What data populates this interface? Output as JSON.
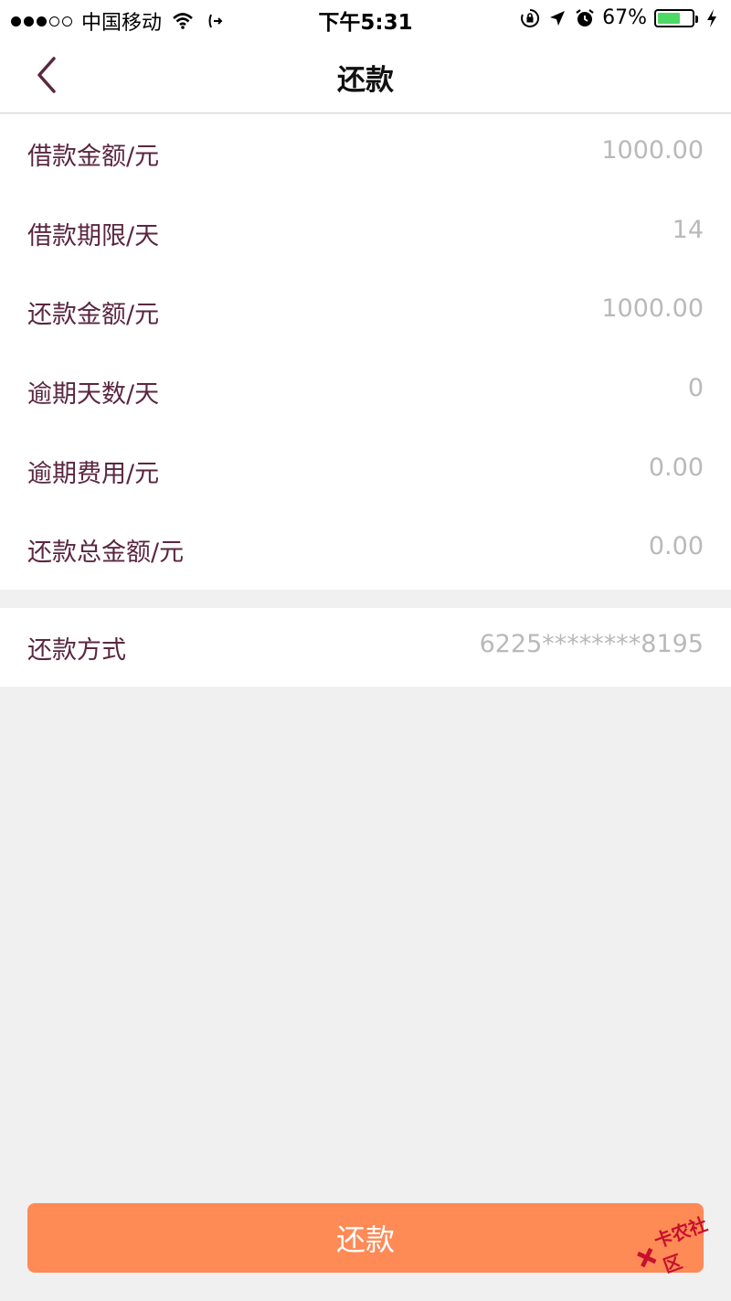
{
  "status_bar": {
    "carrier": "中国移动",
    "time": "下午5:31",
    "battery_percent": "67%",
    "battery_level": 0.67,
    "icons": [
      "signal-dots",
      "wifi-icon",
      "call-forward-icon",
      "orientation-lock-icon",
      "location-arrow-icon",
      "alarm-icon",
      "battery-icon",
      "charging-bolt-icon"
    ]
  },
  "nav": {
    "title": "还款",
    "back_icon": "chevron-left-icon"
  },
  "details": [
    {
      "label": "借款金额/元",
      "value": "1000.00"
    },
    {
      "label": "借款期限/天",
      "value": "14"
    },
    {
      "label": "还款金额/元",
      "value": "1000.00"
    },
    {
      "label": "逾期天数/天",
      "value": "0"
    },
    {
      "label": "逾期费用/元",
      "value": "0.00"
    },
    {
      "label": "还款总金额/元",
      "value": "0.00"
    }
  ],
  "payment_method": {
    "label": "还款方式",
    "value": "6225********8195"
  },
  "action": {
    "pay_label": "还款"
  },
  "watermark": {
    "text": "卡农社区"
  },
  "colors": {
    "label": "#5a2740",
    "value": "#b9b9b9",
    "button": "#fe8a56",
    "background": "#f0f0f0",
    "battery": "#4cd964"
  }
}
